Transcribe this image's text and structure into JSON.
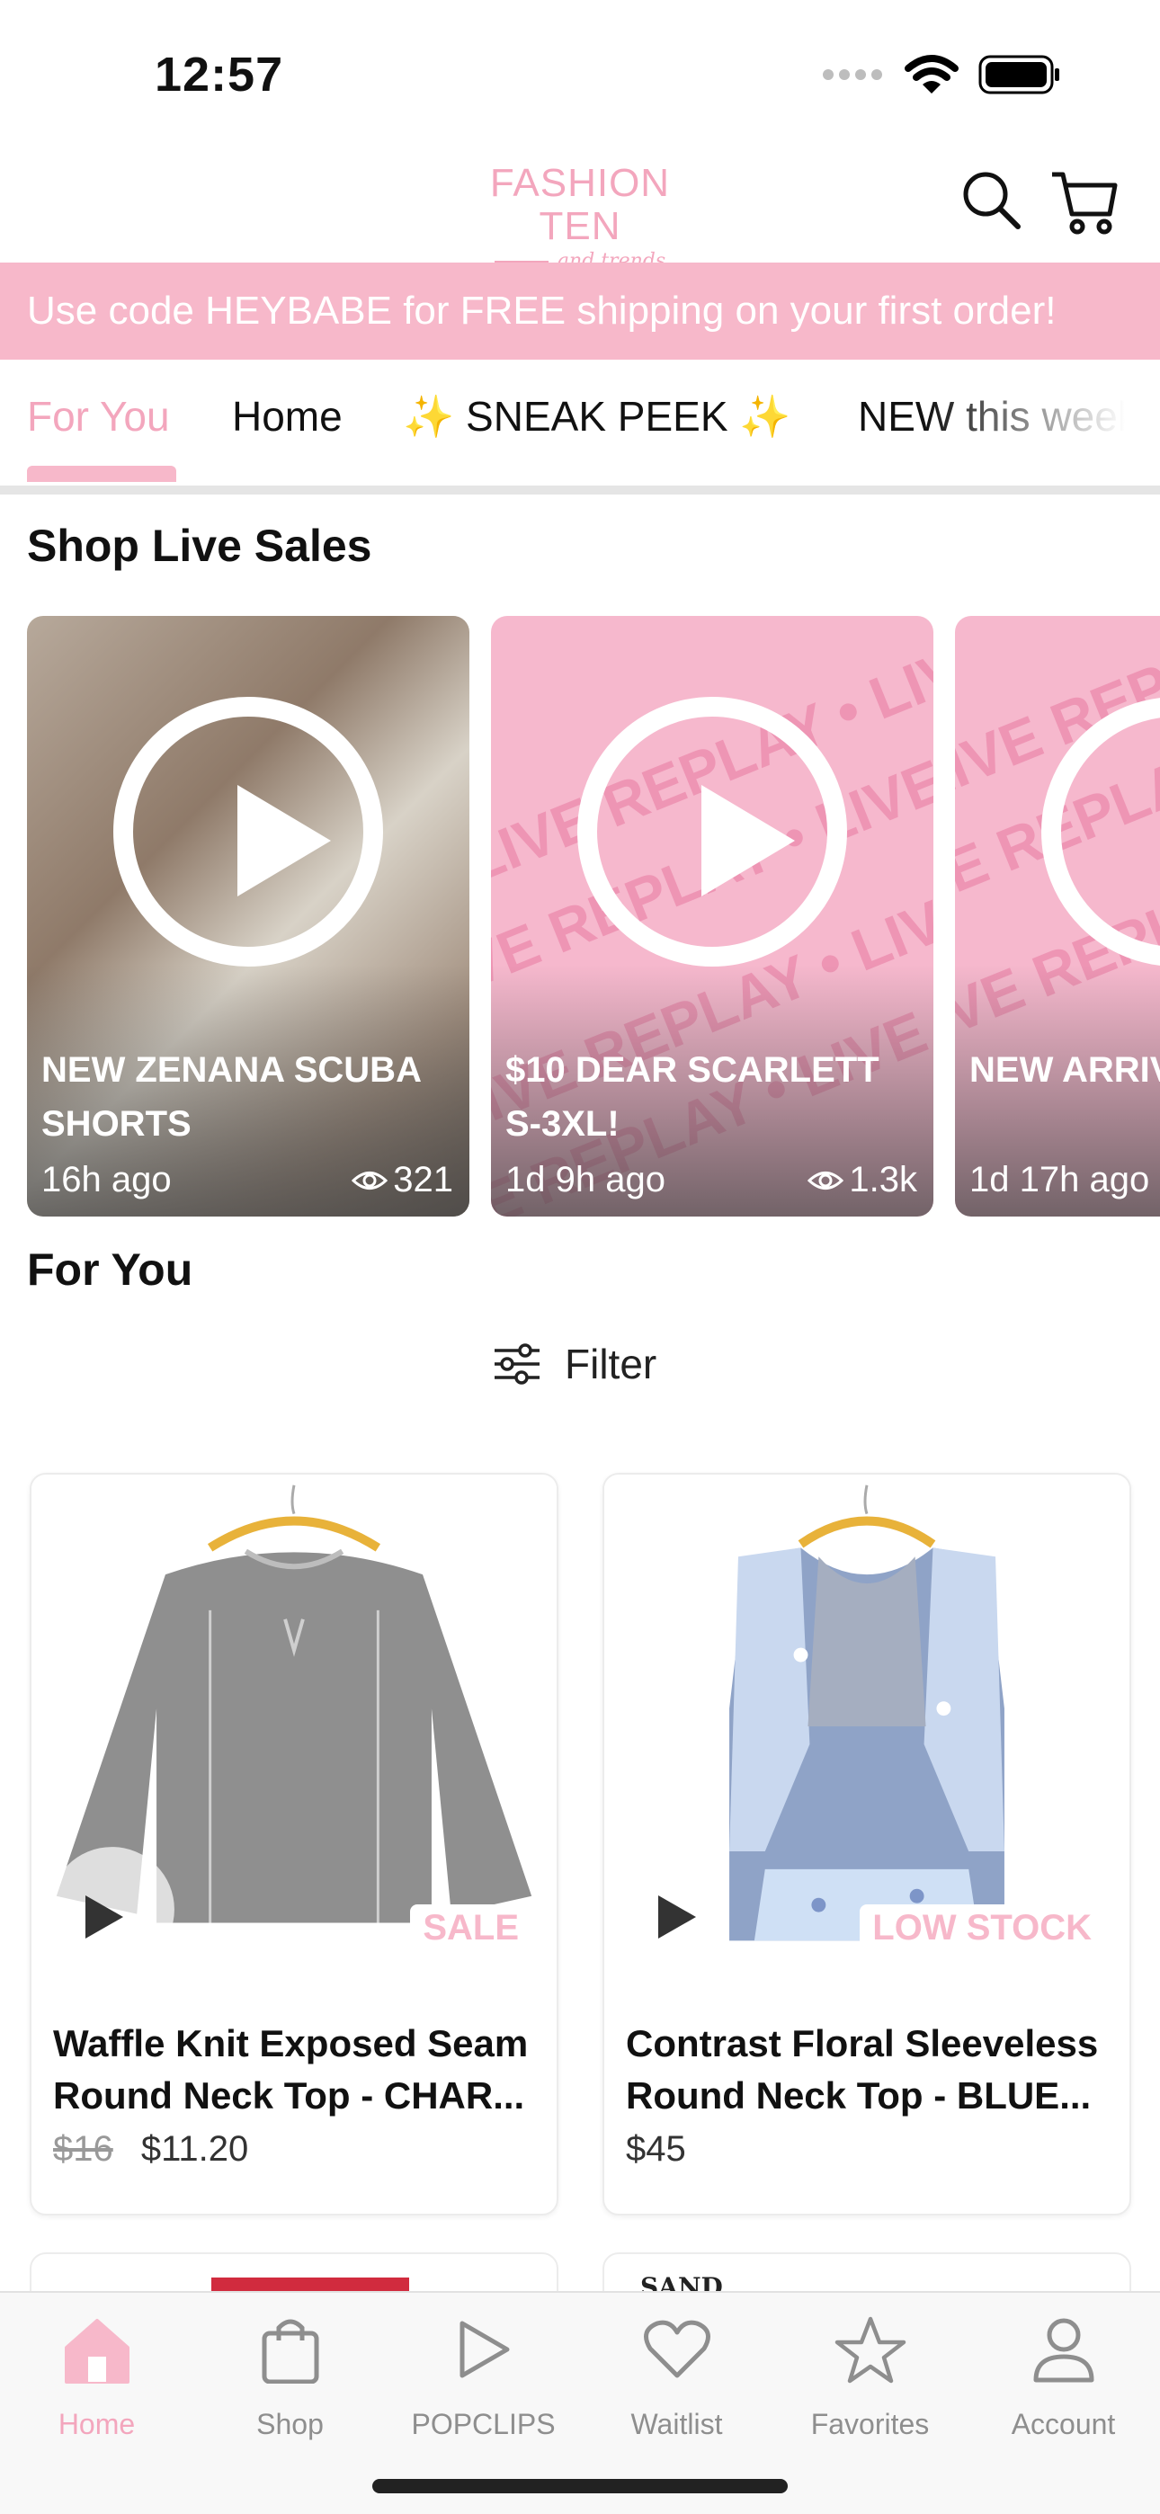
{
  "status_bar": {
    "time": "12:57"
  },
  "header": {
    "logo_main": "FASHION TEN",
    "logo_sub": "and trends",
    "search_icon": "search-icon",
    "cart_icon": "cart-icon"
  },
  "promo": {
    "text": "Use code HEYBABE for FREE shipping on your first order!"
  },
  "tabs": [
    {
      "label": "For You",
      "active": true
    },
    {
      "label": "Home",
      "active": false
    },
    {
      "label": "✨ SNEAK PEEK ✨",
      "active": false
    },
    {
      "label": "NEW this week",
      "active": false
    }
  ],
  "live_section": {
    "title": "Shop Live Sales",
    "cards": [
      {
        "title": "NEW ZENANA SCUBA SHORTS",
        "ago": "16h ago",
        "views": "321",
        "style": "photo"
      },
      {
        "title": "$10 DEAR SCARLETT S-3XL!",
        "ago": "1d 9h ago",
        "views": "1.3k",
        "style": "replay"
      },
      {
        "title": "NEW ARRIVALS LUNCHTIME",
        "ago": "1d 17h ago",
        "views": "",
        "style": "replay"
      }
    ],
    "replay_pattern_text": "LIVE REPLAY • LIVE REPLAY •"
  },
  "for_you": {
    "title": "For You",
    "filter_label": "Filter",
    "products": [
      {
        "name": "Waffle Knit Exposed Seam Round Neck Top - CHAR...",
        "price_old": "$16",
        "price": "$11.20",
        "badge": "SALE"
      },
      {
        "name": "Contrast Floral Sleeveless Round Neck Top - BLUE...",
        "price_old": "",
        "price": "$45",
        "badge": "LOW STOCK"
      }
    ],
    "peek_text": "SAND"
  },
  "bottom_nav": [
    {
      "label": "Home",
      "icon": "home-icon",
      "active": true
    },
    {
      "label": "Shop",
      "icon": "shopping-bag-icon",
      "active": false
    },
    {
      "label": "POPCLIPS",
      "icon": "play-icon",
      "active": false
    },
    {
      "label": "Waitlist",
      "icon": "heart-icon",
      "active": false
    },
    {
      "label": "Favorites",
      "icon": "star-icon",
      "active": false
    },
    {
      "label": "Account",
      "icon": "person-icon",
      "active": false
    }
  ],
  "colors": {
    "accent": "#f3a6bd",
    "banner": "#f7b8ca",
    "nav_inactive": "#8e8e8e"
  }
}
